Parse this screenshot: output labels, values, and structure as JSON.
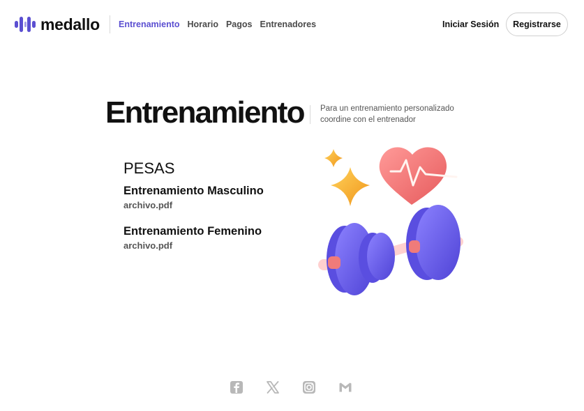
{
  "brand": {
    "name": "medallo",
    "icon": "bars-logo-icon",
    "color": "#5b4fd1"
  },
  "nav": {
    "items": [
      {
        "label": "Entrenamiento",
        "active": true
      },
      {
        "label": "Horario",
        "active": false
      },
      {
        "label": "Pagos",
        "active": false
      },
      {
        "label": "Entrenadores",
        "active": false
      }
    ]
  },
  "auth": {
    "login_label": "Iniciar Sesión",
    "register_label": "Registrarse"
  },
  "hero": {
    "title": "Entrenamiento",
    "subtitle": "Para un entrenamiento personalizado coordine con el entrenador"
  },
  "section": {
    "category": "PESAS",
    "items": [
      {
        "title": "Entrenamiento Masculino",
        "file": "archivo.pdf"
      },
      {
        "title": "Entrenamiento Femenino",
        "file": "archivo.pdf"
      }
    ]
  },
  "illustration": {
    "icon": "dumbbell-heart-illustration"
  },
  "footer": {
    "social": [
      "facebook-icon",
      "x-icon",
      "instagram-icon",
      "gmail-icon"
    ]
  },
  "colors": {
    "accent": "#5b4fd1",
    "dumbbell": "#6a5ee8",
    "heart": "#f07172",
    "sparkle": "#f5a623",
    "social": "#b8b8b8"
  }
}
